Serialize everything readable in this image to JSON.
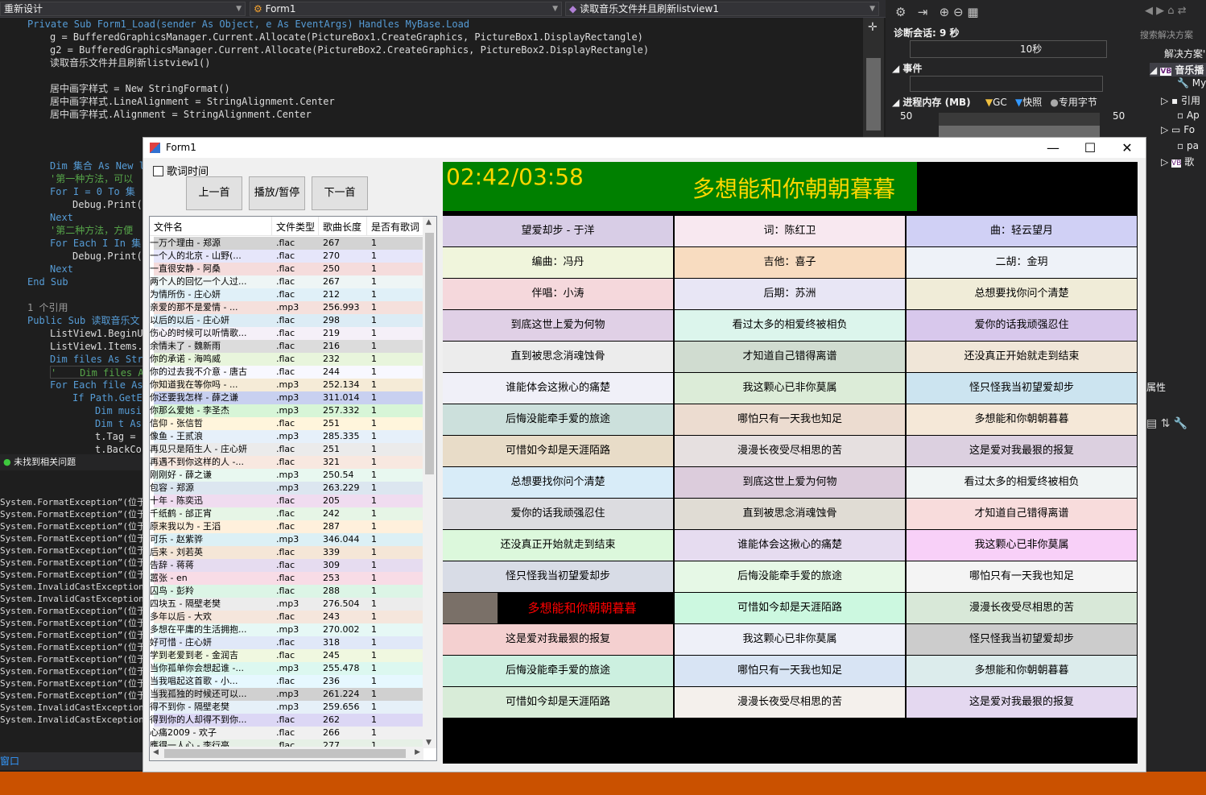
{
  "vs": {
    "combo1": "重新设计",
    "combo2": "Form1",
    "combo3": "读取音乐文件并且刷新listview1",
    "status": "未找到相关问题",
    "output_tab": "窗口",
    "output_lines": [
      "System.FormatException”(位于",
      "System.FormatException”(位于",
      "System.FormatException”(位于",
      "System.FormatException”(位于",
      "System.FormatException”(位于",
      "System.FormatException”(位于",
      "System.FormatException”(位于",
      "System.InvalidCastException”(",
      "System.InvalidCastException”(",
      "System.FormatException”(位于",
      "System.FormatException”(位于",
      "System.FormatException”(位于",
      "System.FormatException”(位于",
      "System.FormatException”(位于",
      "System.FormatException”(位于",
      "System.FormatException”(位于",
      "System.FormatException”(位于",
      "System.InvalidCastException”(",
      "System.InvalidCastException”("
    ],
    "diag_session": "诊断会话: 9 秒",
    "diag_tick": "10秒",
    "events": "事件",
    "memory": "进程内存 (MB)",
    "gc": "GC",
    "snapshot": "快照",
    "private_bytes": "专用字节",
    "mem_left": "50",
    "mem_right": "50",
    "sol_search": "搜索解决方案",
    "sol_items": [
      "解决方案'",
      "音乐播",
      "My",
      "引用",
      "Ap",
      "Fo",
      "pa",
      "歌"
    ],
    "props": "属性"
  },
  "code": {
    "l1": "Private Sub Form1_Load(sender As Object, e As EventArgs) Handles MyBase.Load",
    "l2": "g = BufferedGraphicsManager.Current.Allocate(PictureBox1.CreateGraphics, PictureBox1.DisplayRectangle)",
    "l3": "g2 = BufferedGraphicsManager.Current.Allocate(PictureBox2.CreateGraphics, PictureBox2.DisplayRectangle)",
    "l4": "读取音乐文件并且刷新listview1()",
    "l5": "居中画字样式 = New StringFormat()",
    "l6": "居中画字样式.LineAlignment = StringAlignment.Center",
    "l7": "居中画字样式.Alignment = StringAlignment.Center",
    "l8": "Dim 集合 As New l",
    "l9": "'第一种方法，可以",
    "l10": "For I = 0 To 集",
    "l11": "Debug.Print(",
    "l12": "Next",
    "l13": "'第二种方法，方便",
    "l14": "For Each I In 集",
    "l15": "Debug.Print(",
    "l16": "Next",
    "l17": "End Sub",
    "l18": "1 个引用",
    "l19": "Public Sub 读取音乐文",
    "l20": "ListView1.BeginU",
    "l21": "ListView1.Items.",
    "l22": "Dim files As Str",
    "l23": "'    Dim files A",
    "l24": "For Each file As",
    "l25": "If Path.GetEx",
    "l26": "Dim musi",
    "l27": "Dim t As",
    "l28": "t.Tag = ",
    "l29": "t.BackCo"
  },
  "form": {
    "title": "Form1",
    "checkbox": "歌词时间",
    "prev": "上一首",
    "play": "播放/暂停",
    "next": "下一首",
    "time": "02:42/03:58",
    "current_lyric": "多想能和你朝朝暮暮",
    "headers": [
      "文件名",
      "文件类型",
      "歌曲长度",
      "是否有歌词"
    ],
    "rows": [
      [
        "一万个理由 - 郑源",
        ".flac",
        "267",
        "1",
        "#d3d3d3"
      ],
      [
        "一个人的北京 - 山野(...",
        ".flac",
        "270",
        "1",
        "#e6e6fa"
      ],
      [
        "一直很安静 - 阿桑",
        ".flac",
        "250",
        "1",
        "#f5dcdc"
      ],
      [
        "两个人的回忆一个人过...",
        ".flac",
        "267",
        "1",
        "#eef5f5"
      ],
      [
        "为情所伤 - 庄心妍",
        ".flac",
        "212",
        "1",
        "#e0f0f8"
      ],
      [
        "亲爱的那不是爱情 - ...",
        ".mp3",
        "256.993",
        "1",
        "#f5e0dc"
      ],
      [
        "以后的以后 - 庄心妍",
        ".flac",
        "298",
        "1",
        "#dcecf5"
      ],
      [
        "伤心的时候可以听情歌...",
        ".flac",
        "219",
        "1",
        "#f5f0f8"
      ],
      [
        "余情未了 - 魏新雨",
        ".flac",
        "216",
        "1",
        "#dcdcdc"
      ],
      [
        "你的承诺 - 海鸣威",
        ".flac",
        "232",
        "1",
        "#e8f5dc"
      ],
      [
        "你的过去我不介意 - 唐古",
        ".flac",
        "244",
        "1",
        "#f8f8ff"
      ],
      [
        "你知道我在等你吗 - ...",
        ".mp3",
        "252.134",
        "1",
        "#f5ebd7"
      ],
      [
        "你还要我怎样 - 薛之谦",
        ".mp3",
        "311.014",
        "1",
        "#c8d0f0"
      ],
      [
        "你那么爱她 - 李圣杰",
        ".mp3",
        "257.332",
        "1",
        "#d7f5d7"
      ],
      [
        "信仰 - 张信哲",
        ".flac",
        "251",
        "1",
        "#fff5dc"
      ],
      [
        "像鱼 - 王贰浪",
        ".mp3",
        "285.335",
        "1",
        "#e6f0fa"
      ],
      [
        "再见只是陌生人 - 庄心妍",
        ".flac",
        "251",
        "1",
        "#ebebeb"
      ],
      [
        "再遇不到你这样的人 -...",
        ".flac",
        "321",
        "1",
        "#f8e8e0"
      ],
      [
        "刚刚好 - 薛之谦",
        ".mp3",
        "250.54",
        "1",
        "#e8f8f0"
      ],
      [
        "包容 - 郑源",
        ".mp3",
        "263.229",
        "1",
        "#dce6f0"
      ],
      [
        "十年 - 陈奕迅",
        ".flac",
        "205",
        "1",
        "#f0dcf0"
      ],
      [
        "千纸鹤 - 邰正宵",
        ".flac",
        "242",
        "1",
        "#e6f5e6"
      ],
      [
        "原来我以为 - 王滔",
        ".flac",
        "287",
        "1",
        "#fff0dc"
      ],
      [
        "可乐 - 赵紫骅",
        ".mp3",
        "346.044",
        "1",
        "#dcf0f5"
      ],
      [
        "后来 - 刘若英",
        ".flac",
        "339",
        "1",
        "#f5e6d7"
      ],
      [
        "告辞 - 蒋蒋",
        ".flac",
        "309",
        "1",
        "#e6dcf0"
      ],
      [
        "嚣张 - en",
        ".flac",
        "253",
        "1",
        "#f8dce6"
      ],
      [
        "囚鸟 - 彭羚",
        ".flac",
        "288",
        "1",
        "#dcf5e6"
      ],
      [
        "四块五 - 隔壁老樊",
        ".mp3",
        "276.504",
        "1",
        "#ececec"
      ],
      [
        "多年以后 - 大欢",
        ".flac",
        "243",
        "1",
        "#f5e6dc"
      ],
      [
        "多想在平庸的生活拥抱...",
        ".mp3",
        "270.002",
        "1",
        "#e6f8f5"
      ],
      [
        "好可惜 - 庄心妍",
        ".flac",
        "318",
        "1",
        "#e0e8f8"
      ],
      [
        "学到老爱到老 - 金润吉",
        ".flac",
        "245",
        "1",
        "#f0f8e0"
      ],
      [
        "当你孤单你会想起谁 -...",
        ".mp3",
        "255.478",
        "1",
        "#dcf8f0"
      ],
      [
        "当我唱起这首歌 - 小...",
        ".flac",
        "236",
        "1",
        "#e6f8ff"
      ],
      [
        "当我孤独的时候还可以...",
        ".mp3",
        "261.224",
        "1",
        "#d0d0d0"
      ],
      [
        "得不到你 - 隔壁老樊",
        ".mp3",
        "259.656",
        "1",
        "#e6f0f8"
      ],
      [
        "得到你的人却得不到你...",
        ".flac",
        "262",
        "1",
        "#dcd7f5"
      ],
      [
        "心痛2009 - 欢子",
        ".flac",
        "266",
        "1",
        "#f0f0f0"
      ],
      [
        "應得一人心 - 李行亮",
        ".flac",
        "277",
        "1",
        "#e6f0e6"
      ]
    ],
    "lyrics": [
      [
        [
          "望爱却步 - 于洋",
          "#d8cde6"
        ],
        [
          "词：陈红卫",
          "#f8e8f0"
        ],
        [
          "曲：轻云望月",
          "#d0d0f5"
        ]
      ],
      [
        [
          "编曲：冯丹",
          "#f0f5dc"
        ],
        [
          "吉他：喜子",
          "#f8dcc0"
        ],
        [
          "二胡：金玥",
          "#eef2f8"
        ]
      ],
      [
        [
          "伴唱：小涛",
          "#f5d8dc"
        ],
        [
          "后期：苏洲",
          "#e8e6f5"
        ],
        [
          "总想要找你问个清楚",
          "#f0ecd8"
        ]
      ],
      [
        [
          "到底这世上爱为何物",
          "#e0d0e6"
        ],
        [
          "看过太多的相爱终被相负",
          "#dcf5ec"
        ],
        [
          "爱你的话我顽强忍住",
          "#d8c8ec"
        ]
      ],
      [
        [
          "直到被思念消魂蚀骨",
          "#ececec"
        ],
        [
          "才知道自己错得离谱",
          "#d0dcd0"
        ],
        [
          "还没真正开始就走到结束",
          "#f0e6d8"
        ]
      ],
      [
        [
          "谁能体会这揪心的痛楚",
          "#f0f0f8"
        ],
        [
          "我这颗心已非你莫属",
          "#dcecd8"
        ],
        [
          "怪只怪我当初望爱却步",
          "#cce4f0"
        ]
      ],
      [
        [
          "后悔没能牵手爱的旅途",
          "#cce0dc"
        ],
        [
          "哪怕只有一天我也知足",
          "#ecdcd0"
        ],
        [
          "多想能和你朝朝暮暮",
          "#f5e8d8"
        ]
      ],
      [
        [
          "可惜如今却是天涯陌路",
          "#e8dcc8"
        ],
        [
          "漫漫长夜受尽相思的苦",
          "#e6e0e0"
        ],
        [
          "这是爱对我最狠的报复",
          "#dcd0e0"
        ]
      ],
      [
        [
          "总想要找你问个清楚",
          "#d8ecf8"
        ],
        [
          "到底这世上爱为何物",
          "#dcccdc"
        ],
        [
          "看过太多的相爱终被相负",
          "#f0f4f4"
        ]
      ],
      [
        [
          "爱你的话我顽强忍住",
          "#dcdce0"
        ],
        [
          "直到被思念消魂蚀骨",
          "#e0dcd4"
        ],
        [
          "才知道自己错得离谱",
          "#f8dcdc"
        ]
      ],
      [
        [
          "还没真正开始就走到结束",
          "#dcf8dc"
        ],
        [
          "谁能体会这揪心的痛楚",
          "#e6dcf0"
        ],
        [
          "我这颗心已非你莫属",
          "#f8d0f8"
        ]
      ],
      [
        [
          "怪只怪我当初望爱却步",
          "#d8dce6"
        ],
        [
          "后悔没能牵手爱的旅途",
          "#e6f8e6"
        ],
        [
          "哪怕只有一天我也知足",
          "#f4f4f4"
        ]
      ],
      [
        [
          "多想能和你朝朝暮暮",
          "#000000"
        ],
        [
          "可惜如今却是天涯陌路",
          "#ccf8e0"
        ],
        [
          "漫漫长夜受尽相思的苦",
          "#d8e8d8"
        ]
      ],
      [
        [
          "这是爱对我最狠的报复",
          "#f4d0d0"
        ],
        [
          "我这颗心已非你莫属",
          "#eef0f8"
        ],
        [
          "怪只怪我当初望爱却步",
          "#cccccc"
        ]
      ],
      [
        [
          "后悔没能牵手爱的旅途",
          "#ccf0e0"
        ],
        [
          "哪怕只有一天我也知足",
          "#d8e4f4"
        ],
        [
          "多想能和你朝朝暮暮",
          "#dcecec"
        ]
      ],
      [
        [
          "可惜如今却是天涯陌路",
          "#d8ecd8"
        ],
        [
          "漫漫长夜受尽相思的苦",
          "#f4f0ec"
        ],
        [
          "这是爱对我最狠的报复",
          "#e4d8f0"
        ]
      ]
    ],
    "colors": {
      "accent_green": "#008000",
      "time_text": "#ffd700",
      "highlight_text": "#ff0000"
    }
  }
}
